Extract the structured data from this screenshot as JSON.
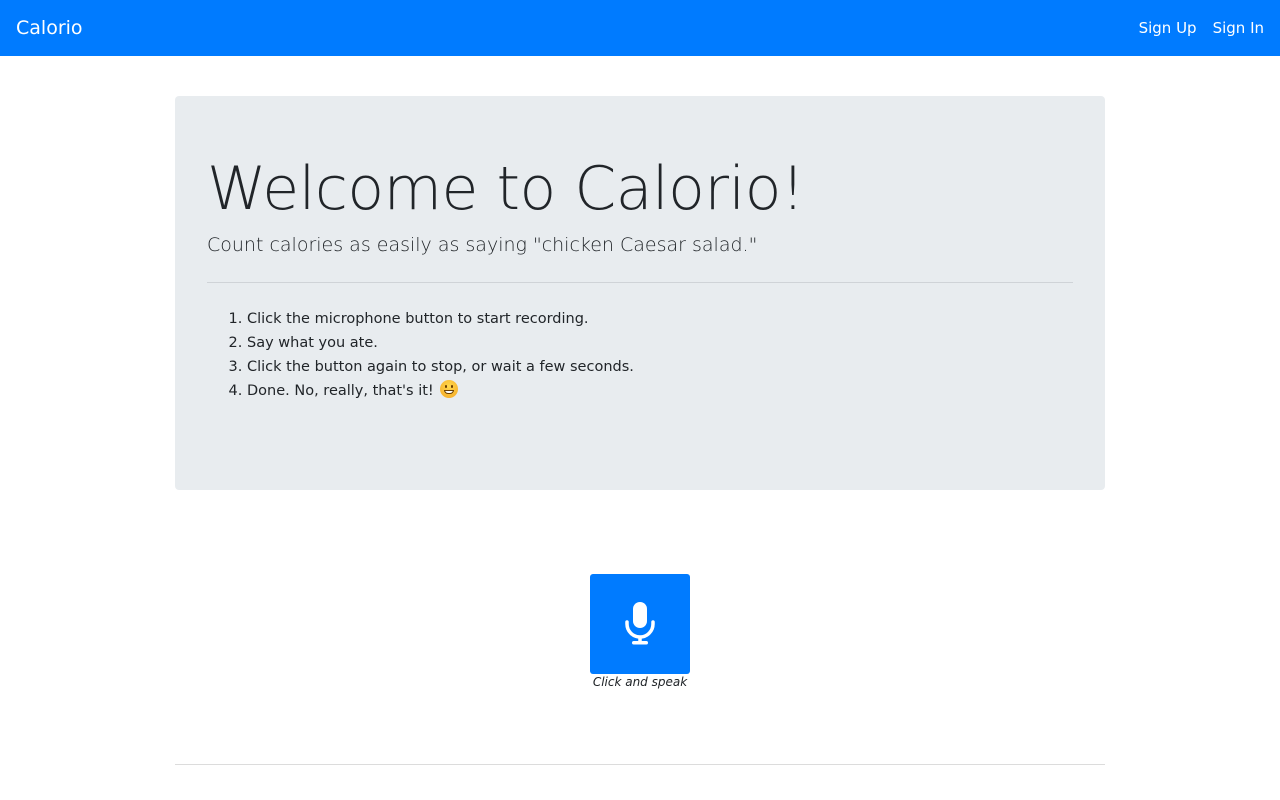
{
  "navbar": {
    "brand": "Calorio",
    "links": [
      {
        "label": "Sign Up"
      },
      {
        "label": "Sign In"
      }
    ],
    "color": "#007bff"
  },
  "jumbotron": {
    "title": "Welcome to Calorio!",
    "lead": "Count calories as easily as saying \"chicken Caesar salad.\"",
    "steps": [
      "Click the microphone button to start recording.",
      "Say what you ate.",
      "Click the button again to stop, or wait a few seconds.",
      "Done. No, really, that's it!"
    ],
    "emoji_icon": "grinning-face-icon"
  },
  "recorder": {
    "button_icon": "microphone-icon",
    "caption": "Click and speak",
    "color": "#007bff"
  }
}
